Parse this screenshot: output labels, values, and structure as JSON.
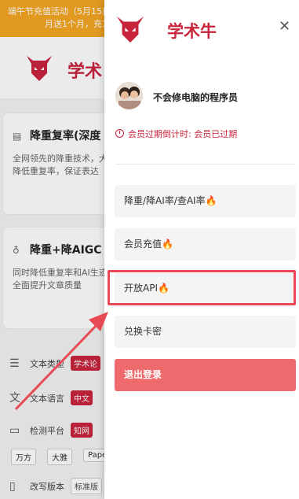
{
  "background": {
    "promo": {
      "line1": "端午节充值活动（5月15日",
      "line2": "月送1个月，充1"
    },
    "brand": "学术",
    "card1": {
      "title": "降重复率(深度",
      "description": "全网领先的降重技术，大幅降低重复率，保证表达"
    },
    "card2": {
      "title": "降重+降AIGC",
      "description": "同时降低重复率和AI生迹，全面提升文章质量"
    },
    "options": [
      {
        "label": "文本类型",
        "icon": "text-type-icon",
        "value": "学术论"
      },
      {
        "label": "文本语言",
        "icon": "translate-icon",
        "value": "中文"
      },
      {
        "label": "检测平台",
        "icon": "monitor-icon",
        "value": "知网"
      },
      {
        "label": "改写版本",
        "icon": "clipboard-icon",
        "value": "标准版"
      }
    ],
    "chips": [
      "万方",
      "大雅",
      "Pape"
    ]
  },
  "drawer": {
    "brand": "学术牛",
    "close_icon": "close-icon",
    "username": "不会修电脑的程序员",
    "expiry_text": "会员过期倒计时: 会员已过期",
    "menu": [
      {
        "label": "降重/降AI率/查AI率",
        "flame": "🔥"
      },
      {
        "label": "会员充值",
        "flame": "🔥"
      },
      {
        "label": "开放API",
        "flame": "🔥"
      },
      {
        "label": "兑换卡密",
        "flame": ""
      }
    ],
    "logout": "退出登录"
  },
  "colors": {
    "brand": "#c8243c",
    "promo": "#f5a623",
    "logout": "#ef6a6d",
    "highlight": "#e84a55"
  }
}
